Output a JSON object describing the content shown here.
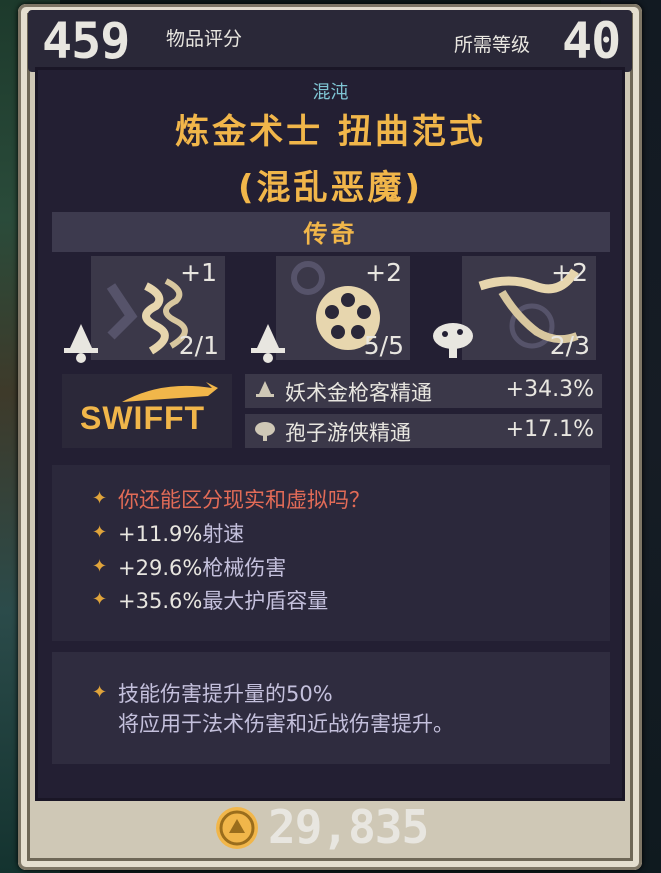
{
  "header": {
    "item_score_value": "459",
    "item_score_label": "物品评分",
    "required_level_label": "所需等级",
    "required_level_value": "40"
  },
  "item": {
    "element": "混沌",
    "name_line1": "炼金术士 扭曲范式",
    "name_line2": "(混乱恶魔)",
    "rarity": "传奇"
  },
  "skills": [
    {
      "plus": "+1",
      "rank": "2/1",
      "icon": "scroll-wave-icon"
    },
    {
      "plus": "+2",
      "rank": "5/5",
      "icon": "revolver-cylinder-icon"
    },
    {
      "plus": "+2",
      "rank": "2/3",
      "icon": "twisted-branch-icon"
    }
  ],
  "class_icons": [
    "witch-hat-icon",
    "witch-hat-icon",
    "mushroom-icon"
  ],
  "manufacturer": "SWIFFT",
  "masteries": [
    {
      "label": "妖术金枪客精通",
      "value": "+34.3%",
      "icon": "witch-hat-icon"
    },
    {
      "label": "孢子游侠精通",
      "value": "+17.1%",
      "icon": "mushroom-icon"
    }
  ],
  "stats": [
    {
      "text": "你还能区分现实和虚拟吗？",
      "style": "red"
    },
    {
      "value": "+11.9%",
      "label": "射速"
    },
    {
      "value": "+29.6%",
      "label": "枪械伤害"
    },
    {
      "value": "+35.6%",
      "label": "最大护盾容量"
    }
  ],
  "passive": {
    "line1": "技能伤害提升量的50%",
    "line2": "将应用于法术伤害和近战伤害提升。"
  },
  "price": "29,835",
  "colors": {
    "accent": "#f1b64a",
    "red": "#e26b57",
    "teal": "#7fc5d4",
    "panel": "#2b283b"
  }
}
